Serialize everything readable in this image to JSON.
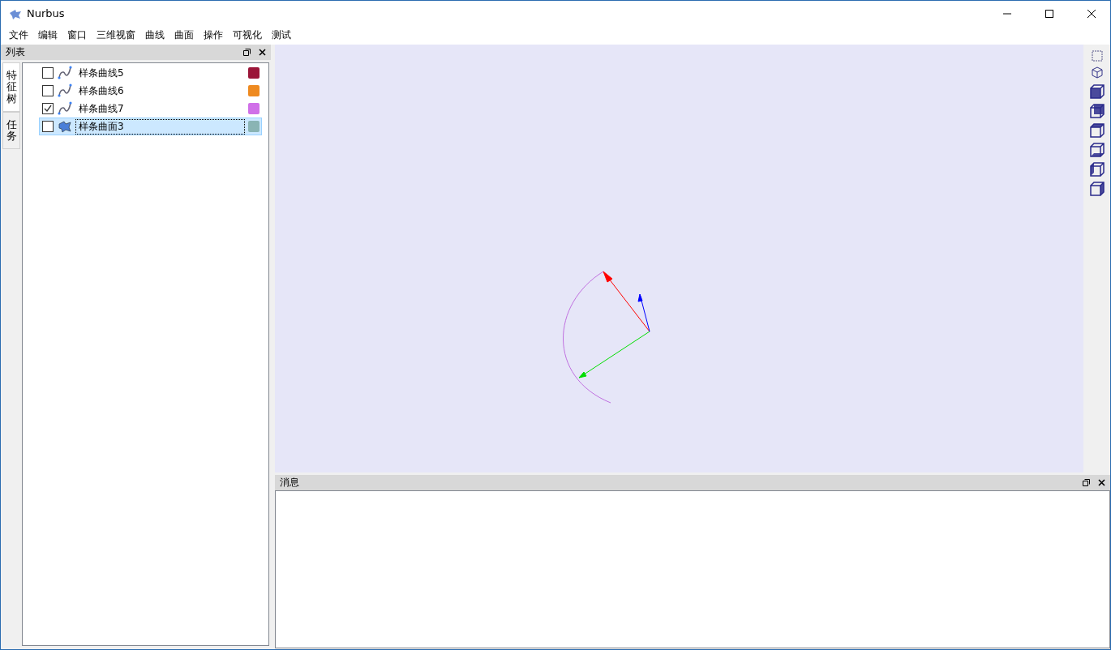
{
  "window": {
    "title": "Nurbus"
  },
  "menu": [
    "文件",
    "编辑",
    "窗口",
    "三维视窗",
    "曲线",
    "曲面",
    "操作",
    "可视化",
    "测试"
  ],
  "list_panel": {
    "title": "列表",
    "side_tabs": [
      {
        "label": "特征树",
        "selected": true
      },
      {
        "label": "任务",
        "selected": false
      }
    ],
    "items": [
      {
        "kind": "curve",
        "label": "样条曲线5",
        "checked": false,
        "selected": false,
        "color": "#9b1538"
      },
      {
        "kind": "curve",
        "label": "样条曲线6",
        "checked": false,
        "selected": false,
        "color": "#ee8a20"
      },
      {
        "kind": "curve",
        "label": "样条曲线7",
        "checked": true,
        "selected": false,
        "color": "#d070e8"
      },
      {
        "kind": "surface",
        "label": "样条曲面3",
        "checked": false,
        "selected": true,
        "color": "#8ab4b4"
      }
    ]
  },
  "message_panel": {
    "title": "消息"
  }
}
